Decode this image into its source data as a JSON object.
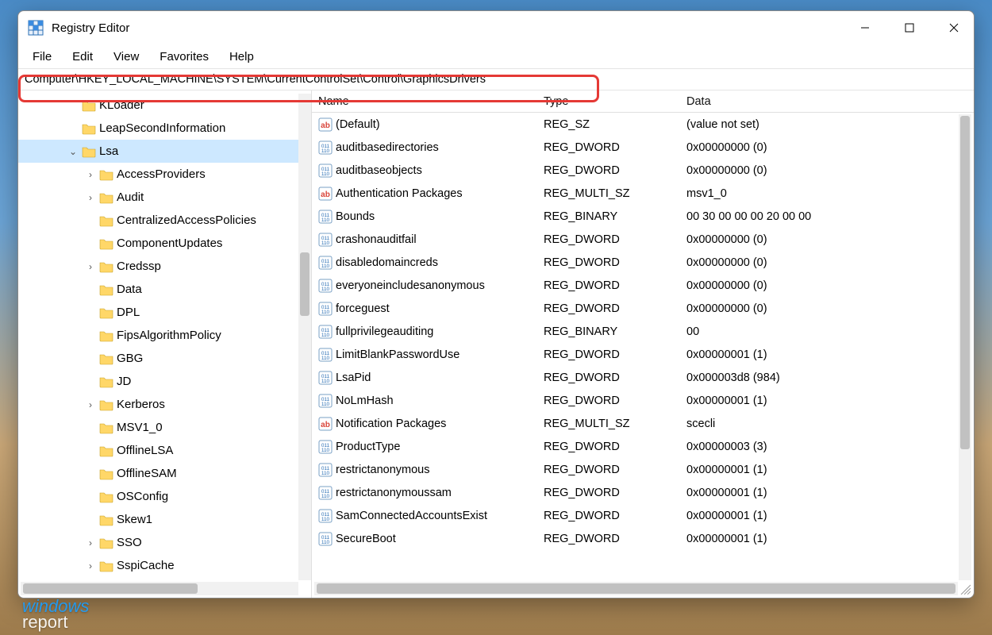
{
  "window": {
    "title": "Registry Editor"
  },
  "menu": {
    "items": [
      "File",
      "Edit",
      "View",
      "Favorites",
      "Help"
    ]
  },
  "address": "Computer\\HKEY_LOCAL_MACHINE\\SYSTEM\\CurrentControlSet\\Control\\GraphicsDrivers",
  "columns": {
    "name": "Name",
    "type": "Type",
    "data": "Data"
  },
  "tree": [
    {
      "label": "KLoader",
      "indent": 2,
      "twisty": ""
    },
    {
      "label": "LeapSecondInformation",
      "indent": 2,
      "twisty": ""
    },
    {
      "label": "Lsa",
      "indent": 2,
      "twisty": "open",
      "selected": true
    },
    {
      "label": "AccessProviders",
      "indent": 3,
      "twisty": "closed"
    },
    {
      "label": "Audit",
      "indent": 3,
      "twisty": "closed"
    },
    {
      "label": "CentralizedAccessPolicies",
      "indent": 3,
      "twisty": ""
    },
    {
      "label": "ComponentUpdates",
      "indent": 3,
      "twisty": ""
    },
    {
      "label": "Credssp",
      "indent": 3,
      "twisty": "closed"
    },
    {
      "label": "Data",
      "indent": 3,
      "twisty": ""
    },
    {
      "label": "DPL",
      "indent": 3,
      "twisty": ""
    },
    {
      "label": "FipsAlgorithmPolicy",
      "indent": 3,
      "twisty": ""
    },
    {
      "label": "GBG",
      "indent": 3,
      "twisty": ""
    },
    {
      "label": "JD",
      "indent": 3,
      "twisty": ""
    },
    {
      "label": "Kerberos",
      "indent": 3,
      "twisty": "closed"
    },
    {
      "label": "MSV1_0",
      "indent": 3,
      "twisty": ""
    },
    {
      "label": "OfflineLSA",
      "indent": 3,
      "twisty": ""
    },
    {
      "label": "OfflineSAM",
      "indent": 3,
      "twisty": ""
    },
    {
      "label": "OSConfig",
      "indent": 3,
      "twisty": ""
    },
    {
      "label": "Skew1",
      "indent": 3,
      "twisty": ""
    },
    {
      "label": "SSO",
      "indent": 3,
      "twisty": "closed"
    },
    {
      "label": "SspiCache",
      "indent": 3,
      "twisty": "closed"
    }
  ],
  "values": [
    {
      "name": "(Default)",
      "type": "REG_SZ",
      "data": "(value not set)",
      "icon": "str"
    },
    {
      "name": "auditbasedirectories",
      "type": "REG_DWORD",
      "data": "0x00000000 (0)",
      "icon": "bin"
    },
    {
      "name": "auditbaseobjects",
      "type": "REG_DWORD",
      "data": "0x00000000 (0)",
      "icon": "bin"
    },
    {
      "name": "Authentication Packages",
      "type": "REG_MULTI_SZ",
      "data": "msv1_0",
      "icon": "str"
    },
    {
      "name": "Bounds",
      "type": "REG_BINARY",
      "data": "00 30 00 00 00 20 00 00",
      "icon": "bin"
    },
    {
      "name": "crashonauditfail",
      "type": "REG_DWORD",
      "data": "0x00000000 (0)",
      "icon": "bin"
    },
    {
      "name": "disabledomaincreds",
      "type": "REG_DWORD",
      "data": "0x00000000 (0)",
      "icon": "bin"
    },
    {
      "name": "everyoneincludesanonymous",
      "type": "REG_DWORD",
      "data": "0x00000000 (0)",
      "icon": "bin"
    },
    {
      "name": "forceguest",
      "type": "REG_DWORD",
      "data": "0x00000000 (0)",
      "icon": "bin"
    },
    {
      "name": "fullprivilegeauditing",
      "type": "REG_BINARY",
      "data": "00",
      "icon": "bin"
    },
    {
      "name": "LimitBlankPasswordUse",
      "type": "REG_DWORD",
      "data": "0x00000001 (1)",
      "icon": "bin"
    },
    {
      "name": "LsaPid",
      "type": "REG_DWORD",
      "data": "0x000003d8 (984)",
      "icon": "bin"
    },
    {
      "name": "NoLmHash",
      "type": "REG_DWORD",
      "data": "0x00000001 (1)",
      "icon": "bin"
    },
    {
      "name": "Notification Packages",
      "type": "REG_MULTI_SZ",
      "data": "scecli",
      "icon": "str"
    },
    {
      "name": "ProductType",
      "type": "REG_DWORD",
      "data": "0x00000003 (3)",
      "icon": "bin"
    },
    {
      "name": "restrictanonymous",
      "type": "REG_DWORD",
      "data": "0x00000001 (1)",
      "icon": "bin"
    },
    {
      "name": "restrictanonymoussam",
      "type": "REG_DWORD",
      "data": "0x00000001 (1)",
      "icon": "bin"
    },
    {
      "name": "SamConnectedAccountsExist",
      "type": "REG_DWORD",
      "data": "0x00000001 (1)",
      "icon": "bin"
    },
    {
      "name": "SecureBoot",
      "type": "REG_DWORD",
      "data": "0x00000001 (1)",
      "icon": "bin"
    }
  ],
  "watermark": {
    "line1": "windows",
    "line2": "report"
  }
}
